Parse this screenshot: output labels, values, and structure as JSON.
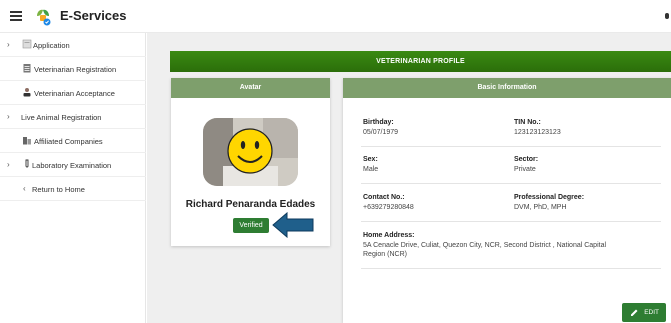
{
  "app": {
    "title": "E-Services"
  },
  "sidebar": {
    "items": [
      {
        "label": "Application",
        "has_chevron": true
      },
      {
        "label": "Veterinarian Registration",
        "has_chevron": false
      },
      {
        "label": "Veterinarian Acceptance",
        "has_chevron": false
      },
      {
        "label": "Live Animal Registration",
        "has_chevron": true
      },
      {
        "label": "Affiliated Companies",
        "has_chevron": false
      },
      {
        "label": "Laboratory Examination",
        "has_chevron": true
      },
      {
        "label": "Return to Home",
        "has_chevron": false
      }
    ]
  },
  "banner": {
    "title": "VETERINARIAN PROFILE"
  },
  "avatar_card": {
    "title": "Avatar",
    "name": "Richard Penaranda Edades",
    "status": "Verified"
  },
  "info_card": {
    "title": "Basic Information",
    "birthday_label": "Birthday:",
    "birthday": "05/07/1979",
    "tin_label": "TIN No.:",
    "tin": "123123123123",
    "sex_label": "Sex:",
    "sex": "Male",
    "sector_label": "Sector:",
    "sector": "Private",
    "contact_label": "Contact No.:",
    "contact": "+639279280848",
    "degree_label": "Professional Degree:",
    "degree": "DVM, PhD, MPH",
    "address_label": "Home Address:",
    "address_line1": "5A Cenacle Drive, Culiat, Quezon City, NCR, Second District , National Capital",
    "address_line2": "Region (NCR)",
    "edit_label": "EDIT"
  },
  "colors": {
    "banner_green": "#2b6e0a",
    "card_header": "#7e9f6c",
    "button_green": "#2e7d32",
    "annotation_arrow": "#1f5f8b"
  }
}
